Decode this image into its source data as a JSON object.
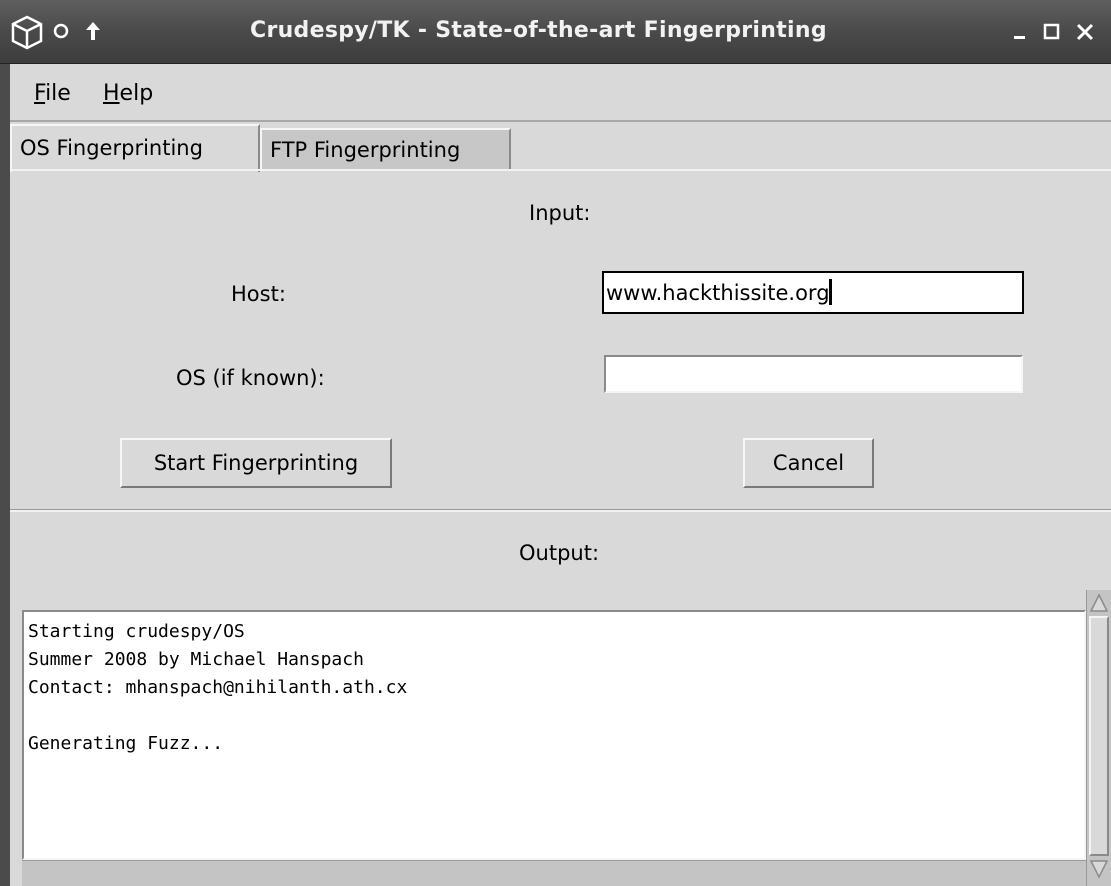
{
  "window": {
    "title": "Crudespy/TK - State-of-the-art Fingerprinting",
    "icons": {
      "app": "cube-icon",
      "pin": "circle-icon",
      "raise": "arrow-up-icon"
    },
    "controls": {
      "minimize": "_",
      "maximize": "□",
      "close": "×"
    }
  },
  "menubar": {
    "items": [
      {
        "mnemonic": "F",
        "rest": "ile"
      },
      {
        "mnemonic": "H",
        "rest": "elp"
      }
    ]
  },
  "tabs": [
    {
      "label": "OS Fingerprinting",
      "active": true
    },
    {
      "label": "FTP Fingerprinting",
      "active": false
    }
  ],
  "input": {
    "heading": "Input:",
    "host_label": "Host:",
    "host_value": "www.hackthissite.org",
    "os_label": "OS (if known):",
    "os_value": ""
  },
  "buttons": {
    "start": "Start Fingerprinting",
    "cancel": "Cancel"
  },
  "output": {
    "heading": "Output:",
    "text": "Starting crudespy/OS\nSummer 2008 by Michael Hanspach\nContact: mhanspach@nihilanth.ath.cx\n\nGenerating Fuzz..."
  }
}
